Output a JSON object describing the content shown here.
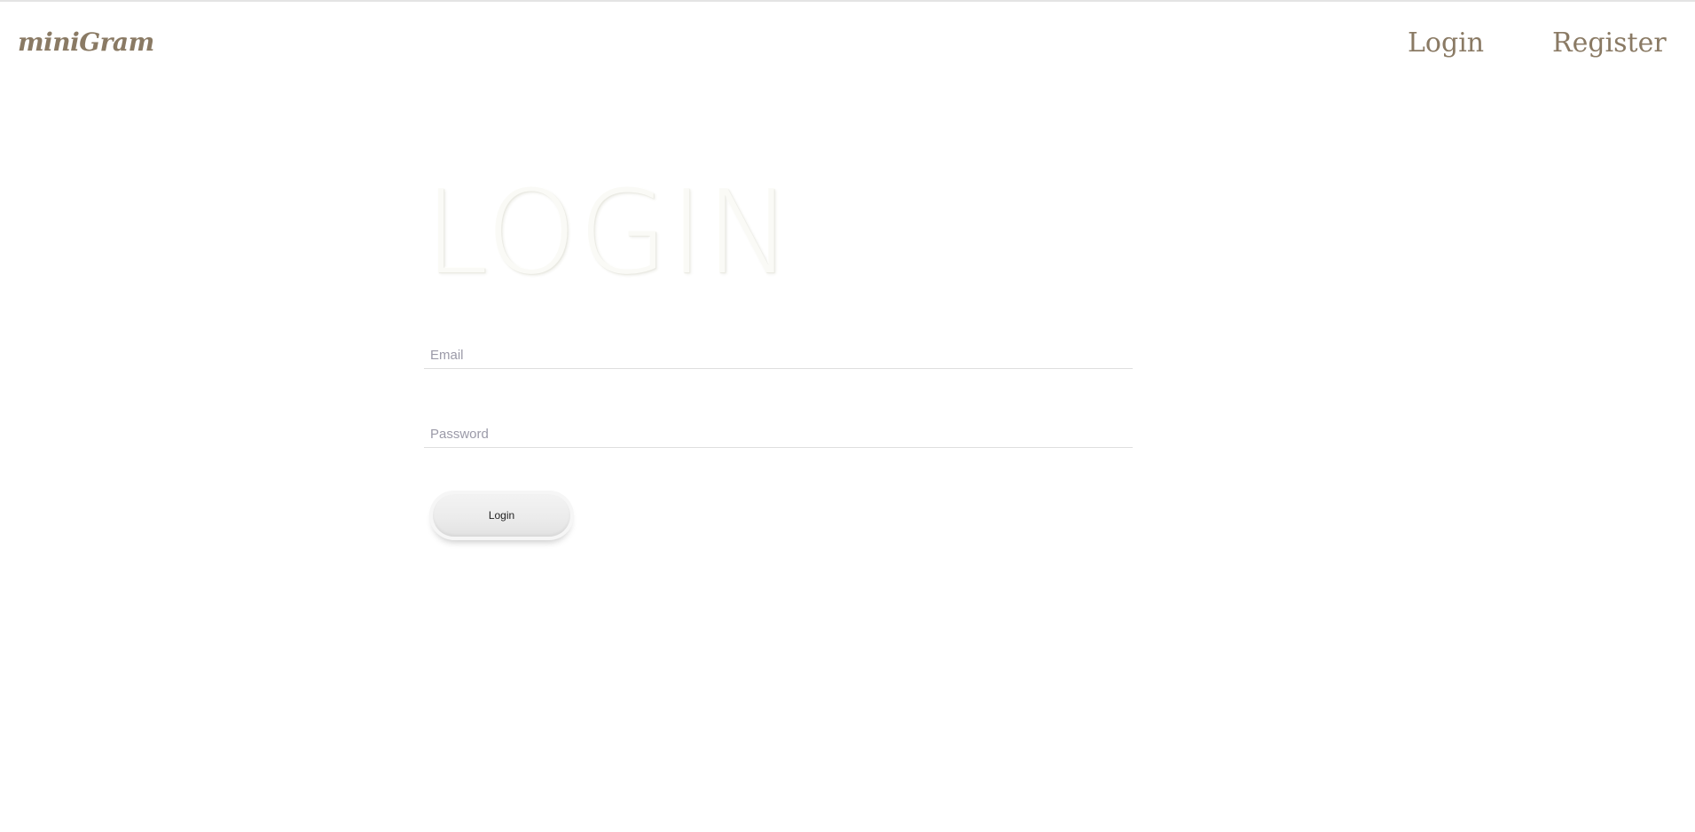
{
  "header": {
    "brand": "miniGram",
    "nav": {
      "login_label": "Login",
      "register_label": "Register"
    }
  },
  "form": {
    "title": "LOGIN",
    "email": {
      "placeholder": "Email",
      "value": ""
    },
    "password": {
      "placeholder": "Password",
      "value": ""
    },
    "submit_label": "Login"
  },
  "colors": {
    "brand": "#8a7a64",
    "title_embossed": "#fafaf6",
    "placeholder": "#9b9aa8",
    "field_underline": "#dedede"
  }
}
